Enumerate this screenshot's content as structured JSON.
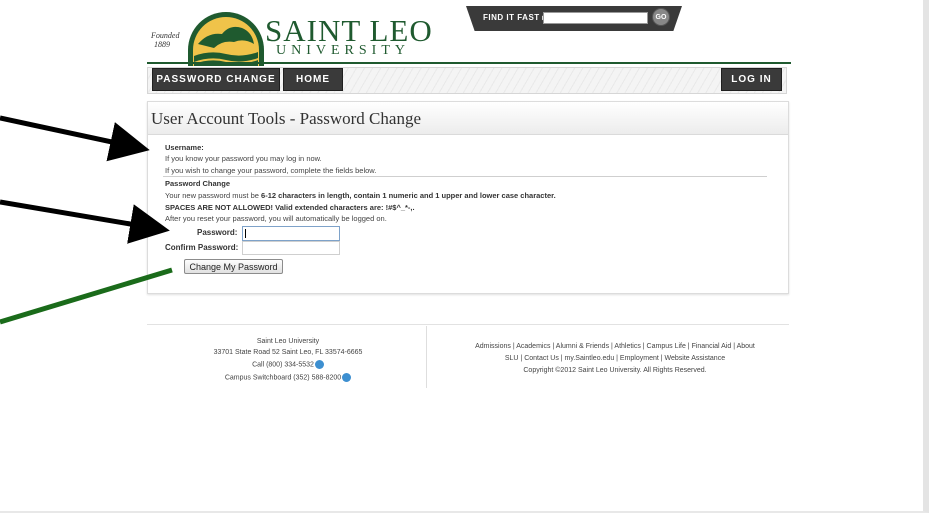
{
  "header": {
    "founded": "Founded",
    "founded_year": "1889",
    "logo_name": "SAINT LEO",
    "logo_sub": "UNIVERSITY",
    "find_label": "FIND IT FAST ▸",
    "find_placeholder": "",
    "go_label": "GO"
  },
  "nav": {
    "password_change": "PASSWORD CHANGE",
    "home": "HOME",
    "login": "LOG IN"
  },
  "panel": {
    "title": "User Account Tools - Password Change",
    "username_label": "Username:",
    "line1": "If you know your password you may log in now.",
    "line2": "If you wish to change your password, complete the fields below.",
    "section_title": "Password Change",
    "rule_prefix": "Your new password must be",
    "rule_bold": "6-12 characters in length, contain 1 numeric and 1 upper and lower case character.",
    "spaces_bold": "SPACES ARE NOT ALLOWED!  Valid extended characters are:  !#$^_*-,.",
    "auto_login": "After you reset your password, you will automatically be logged on.",
    "password_label": "Password:",
    "password_value": "",
    "confirm_label": "Confirm Password:",
    "confirm_value": "",
    "submit_label": "Change My Password"
  },
  "footer": {
    "org": "Saint Leo University",
    "address": "33701 State Road 52 Saint Leo, FL 33574-6665",
    "call": "Call (800) 334-5532",
    "switchboard": "Campus Switchboard (352) 588-8200",
    "links_line1": "Admissions | Academics | Alumni & Friends | Athletics | Campus Life | Financial Aid | About",
    "links_line2": "SLU | Contact Us | my.Saintleo.edu | Employment | Website Assistance",
    "copyright": "Copyright ©2012 Saint Leo University. All Rights Reserved."
  },
  "colors": {
    "brand_green": "#1f5a2f",
    "nav_dark": "#3a3a3a",
    "arrow_black": "#000000",
    "arrow_green": "#1a6b1a"
  }
}
